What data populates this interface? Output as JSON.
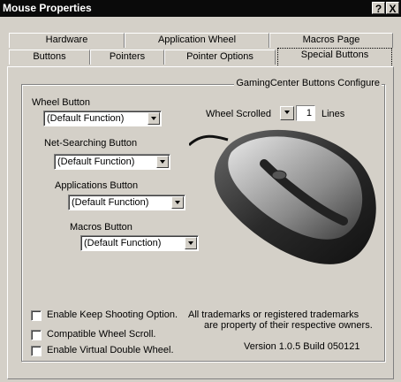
{
  "window": {
    "title": "Mouse Properties",
    "help_label": "?",
    "close_label": "X"
  },
  "tabs_row1": [
    "Hardware",
    "Application Wheel",
    "Macros Page"
  ],
  "tabs_row2": [
    "Buttons",
    "Pointers",
    "Pointer Options",
    "Special Buttons"
  ],
  "group": {
    "title": "GamingCenter Buttons Configure"
  },
  "wheel_button": {
    "label": "Wheel Button",
    "value": "(Default Function)"
  },
  "net_button": {
    "label": "Net-Searching Button",
    "value": "(Default Function)"
  },
  "apps_button": {
    "label": "Applications Button",
    "value": "(Default Function)"
  },
  "macros_button": {
    "label": "Macros Button",
    "value": "(Default Function)"
  },
  "wheel_scroll": {
    "label": "Wheel Scrolled",
    "value": "1",
    "unit": "Lines"
  },
  "options": {
    "keep_shooting": "Enable Keep Shooting Option.",
    "compat_wheel": "Compatible Wheel Scroll.",
    "virtual_double": "Enable Virtual Double Wheel."
  },
  "trademark": {
    "line1": "All trademarks or registered trademarks",
    "line2": "are property of their respective owners."
  },
  "version": "Version 1.0.5 Build 050121"
}
